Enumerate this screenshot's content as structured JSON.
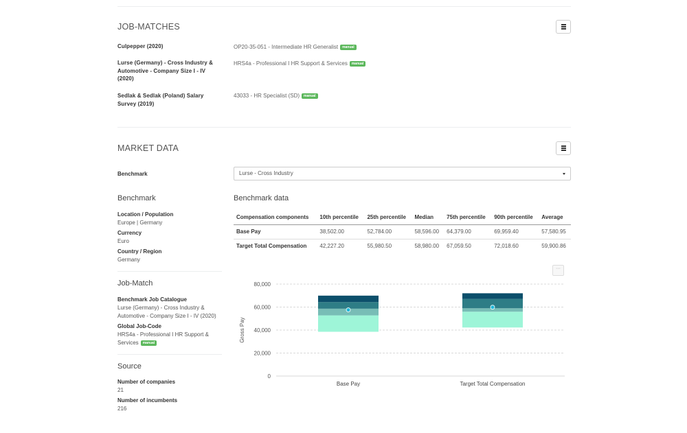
{
  "job_matches": {
    "title": "JOB-MATCHES",
    "rows": [
      {
        "survey": "Culpepper (2020)",
        "job": "OP20-35-051 - Intermediate HR Generalist",
        "badge": "manual"
      },
      {
        "survey": "Lurse (Germany) - Cross Industry & Automotive - Company Size I - IV (2020)",
        "job": "HRS4a - Professional I HR Support & Services",
        "badge": "manual"
      },
      {
        "survey": "Sedlak & Sedlak (Poland) Salary Survey (2019)",
        "job": "43033 - HR Specialist (SD)",
        "badge": "manual"
      }
    ]
  },
  "market_data": {
    "title": "MARKET DATA",
    "benchmark_label": "Benchmark",
    "benchmark_selected": "Lurse - Cross Industry"
  },
  "sidebar": {
    "benchmark": {
      "heading": "Benchmark",
      "location_label": "Location / Population",
      "location_value": "Europe | Germany",
      "currency_label": "Currency",
      "currency_value": "Euro",
      "country_label": "Country / Region",
      "country_value": "Germany"
    },
    "job_match": {
      "heading": "Job-Match",
      "catalogue_label": "Benchmark Job Catalogue",
      "catalogue_value": "Lurse (Germany) - Cross Industry & Automotive - Company Size I - IV (2020)",
      "code_label": "Global Job-Code",
      "code_value": "HRS4a - Professional I HR Support & Services",
      "code_badge": "manual"
    },
    "source": {
      "heading": "Source",
      "companies_label": "Number of companies",
      "companies_value": "21",
      "incumbents_label": "Number of incumbents",
      "incumbents_value": "216"
    }
  },
  "benchmark_data": {
    "heading": "Benchmark data",
    "columns": [
      "Compensation components",
      "10th percentile",
      "25th percentile",
      "Median",
      "75th percentile",
      "90th percentile",
      "Average"
    ],
    "rows": [
      [
        "Base Pay",
        "38,502.00",
        "52,784.00",
        "58,596.00",
        "64,379.00",
        "69,959.40",
        "57,580.95"
      ],
      [
        "Target Total Compensation",
        "42,227.20",
        "55,980.50",
        "58,980.00",
        "67,059.50",
        "72,018.60",
        "59,900.86"
      ]
    ],
    "chart_menu_glyph": "···"
  },
  "chart_data": {
    "type": "boxplot",
    "ylabel": "Gross Pay",
    "ylim": [
      0,
      80000
    ],
    "yticks": [
      0,
      20000,
      40000,
      60000,
      80000
    ],
    "ytick_labels": [
      "0",
      "20,000",
      "40,000",
      "60,000",
      "80,000"
    ],
    "categories": [
      "Base Pay",
      "Target Total Compensation"
    ],
    "series": [
      {
        "category": "Base Pay",
        "p10": 38502.0,
        "p25": 52784.0,
        "median": 58596.0,
        "p75": 64379.0,
        "p90": 69959.4,
        "average": 57580.95
      },
      {
        "category": "Target Total Compensation",
        "p10": 42227.2,
        "p25": 55980.5,
        "median": 58980.0,
        "p75": 67059.5,
        "p90": 72018.6,
        "average": 59900.86
      }
    ],
    "colors": {
      "p10_p25": "#9ef5d8",
      "p25_median": "#78bdb6",
      "median_p75": "#2e7d86",
      "p75_p90": "#0c4f6b",
      "average_marker": "#21b8d9",
      "grid": "#cccccc"
    }
  }
}
